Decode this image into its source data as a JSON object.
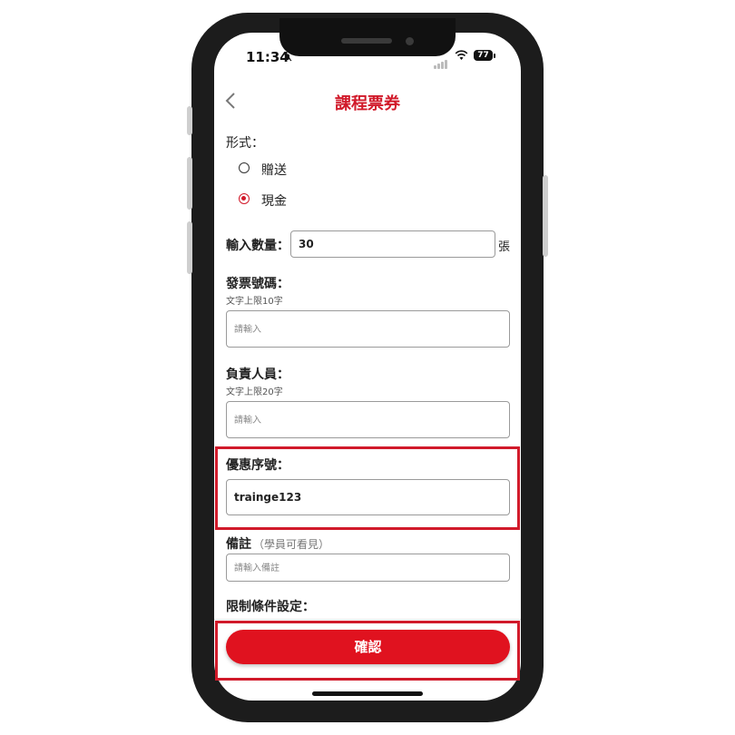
{
  "status_bar": {
    "time": "11:34",
    "battery": "77"
  },
  "header": {
    "title": "課程票券",
    "back_icon": "chevron-left-icon"
  },
  "form": {
    "type_label": "形式：",
    "type_options": [
      {
        "label": "贈送",
        "checked": false
      },
      {
        "label": "現金",
        "checked": true
      }
    ],
    "quantity_label": "輸入數量：",
    "quantity_value": "30",
    "quantity_unit": "張",
    "invoice_label": "發票號碼：",
    "invoice_limit": "文字上限10字",
    "invoice_placeholder": "請輸入",
    "person_label": "負責人員：",
    "person_limit": "文字上限20字",
    "person_placeholder": "請輸入",
    "coupon_label": "優惠序號：",
    "coupon_value": "trainge123",
    "note_label": "備註",
    "note_hint": "（學員可看見）",
    "note_placeholder": "請輸入備註",
    "restriction_label": "限制條件設定："
  },
  "footer": {
    "confirm_label": "確認"
  },
  "colors": {
    "accent": "#d11a2a",
    "button": "#e0121f",
    "highlight": "#d11a2a"
  }
}
